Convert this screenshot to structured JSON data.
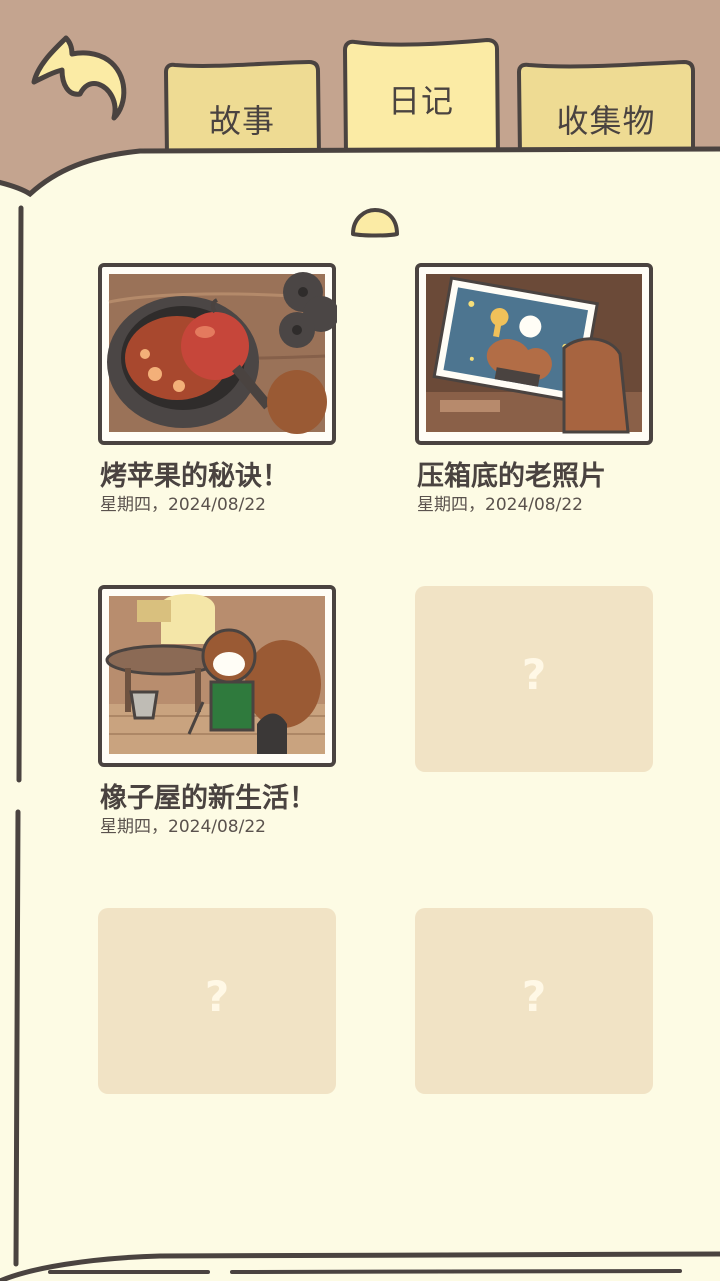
{
  "tabs": {
    "story": "故事",
    "diary": "日记",
    "collection": "收集物"
  },
  "entries": [
    {
      "title": "烤苹果的秘诀！",
      "date": "星期四，2024/08/22"
    },
    {
      "title": "压箱底的老照片",
      "date": "星期四，2024/08/22"
    },
    {
      "title": "橡子屋的新生活！",
      "date": "星期四，2024/08/22"
    }
  ],
  "locked_mark": "?",
  "colors": {
    "frame": "#c4a48f",
    "paper": "#fdfbe4",
    "tab": "#eedb93",
    "tab_active": "#fbeba5",
    "ink": "#4a4340",
    "locked": "#f1e3c5"
  }
}
